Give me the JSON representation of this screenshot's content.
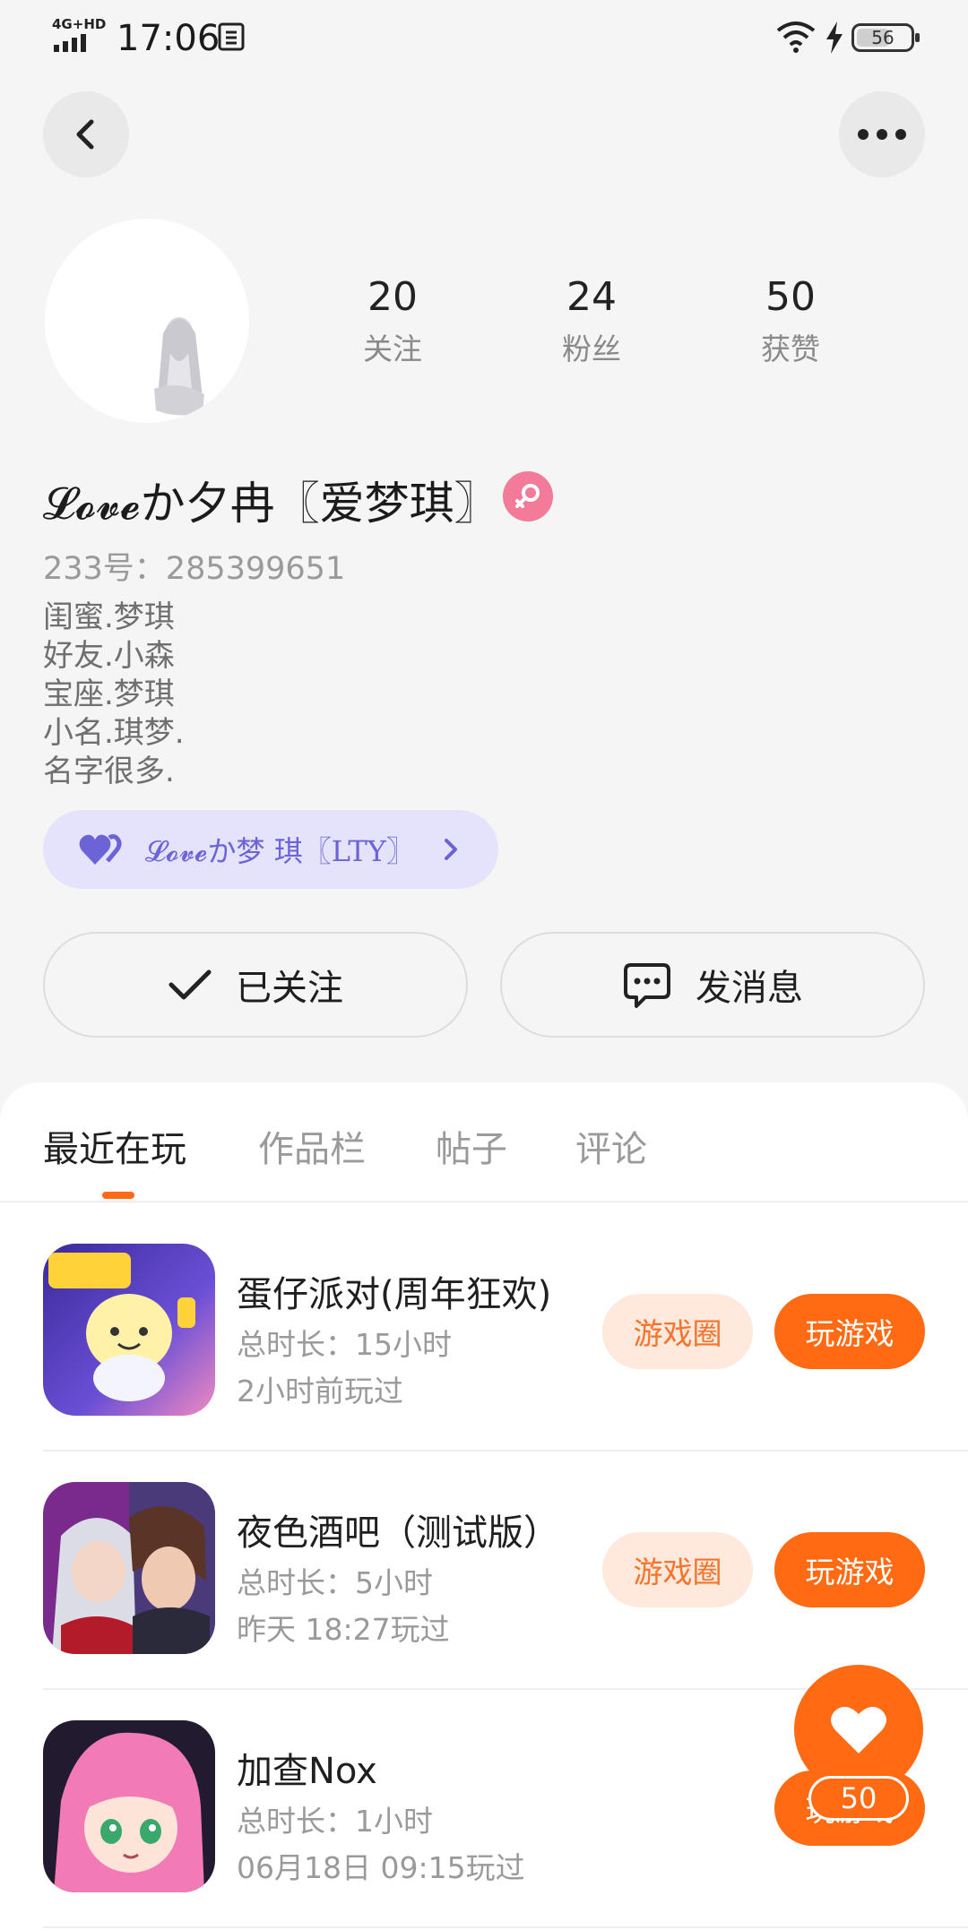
{
  "status_bar": {
    "network": "4G+HD",
    "time": "17:06",
    "battery": "56"
  },
  "profile": {
    "stats": [
      {
        "value": "20",
        "label": "关注"
      },
      {
        "value": "24",
        "label": "粉丝"
      },
      {
        "value": "50",
        "label": "获赞"
      }
    ],
    "username": "𝓛𝓸𝓿𝓮か夕冉〖爱梦琪〗",
    "uid": "233号：285399651",
    "bio": "闺蜜.梦琪\n好友.小森\n宝座.梦琪\n小名.琪梦.\n名字很多.",
    "group_label": "𝓛𝓸𝓿𝓮か梦 琪〖LTY〗",
    "follow_label": "已关注",
    "message_label": "发消息"
  },
  "tabs": [
    {
      "label": "最近在玩"
    },
    {
      "label": "作品栏"
    },
    {
      "label": "帖子"
    },
    {
      "label": "评论"
    }
  ],
  "games": [
    {
      "title": "蛋仔派对(周年狂欢)",
      "duration": "总时长：15小时",
      "last_played": "2小时前玩过",
      "circle_label": "游戏圈",
      "play_label": "玩游戏"
    },
    {
      "title": "夜色酒吧（测试版）",
      "duration": "总时长：5小时",
      "last_played": "昨天 18:27玩过",
      "circle_label": "游戏圈",
      "play_label": "玩游戏"
    },
    {
      "title": "加查Nox",
      "duration": "总时长：1小时",
      "last_played": "06月18日 09:15玩过",
      "circle_label": "",
      "play_label": "玩游戏"
    }
  ],
  "like_fab": {
    "count": "50"
  },
  "colors": {
    "accent": "#ff6a12",
    "accent_soft": "#ffe8dc",
    "group_bg": "#e4e3fb",
    "group_text": "#6b63d6",
    "gender": "#f47a9a"
  }
}
